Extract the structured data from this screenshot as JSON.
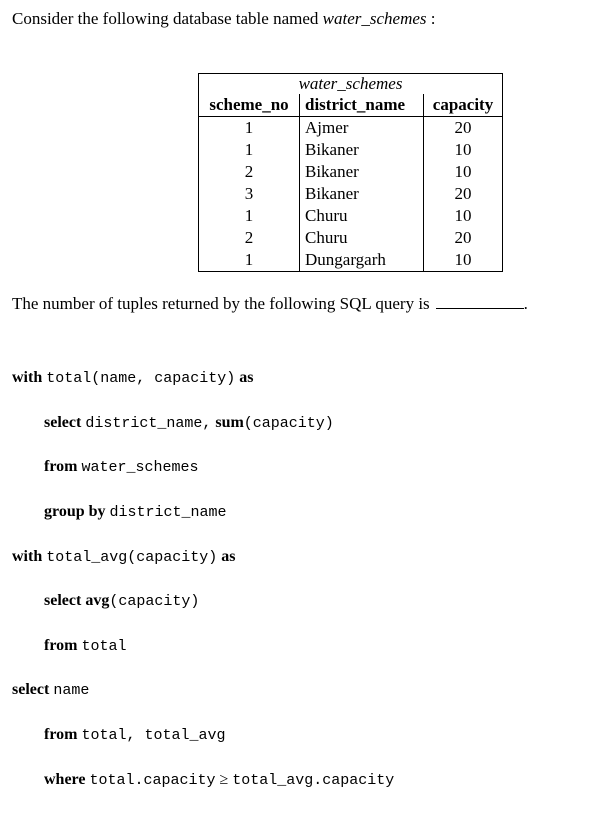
{
  "intro": {
    "prefix": "Consider the following database table named ",
    "table_name": "water_schemes",
    "suffix": " :"
  },
  "table": {
    "caption": "water_schemes",
    "headers": [
      "scheme_no",
      "district_name",
      "capacity"
    ],
    "rows": [
      [
        "1",
        "Ajmer",
        "20"
      ],
      [
        "1",
        "Bikaner",
        "10"
      ],
      [
        "2",
        "Bikaner",
        "10"
      ],
      [
        "3",
        "Bikaner",
        "20"
      ],
      [
        "1",
        "Churu",
        "10"
      ],
      [
        "2",
        "Churu",
        "20"
      ],
      [
        "1",
        "Dungargarh",
        "10"
      ]
    ]
  },
  "question": {
    "text": "The number of tuples returned by the following SQL query is",
    "end": "."
  },
  "sql": {
    "l1_kw": "with",
    "l1_code": "total(name, capacity)",
    "l1_kw2": "as",
    "l2_kw": "select",
    "l2_code": "district_name,",
    "l2_kw2": "sum",
    "l2_code2": "(capacity)",
    "l3_kw": "from",
    "l3_code": "water_schemes",
    "l4_kw": "group by",
    "l4_code": "district_name",
    "l5_kw": "with",
    "l5_code": "total_avg(capacity)",
    "l5_kw2": "as",
    "l6_kw": "select",
    "l6_kw2": "avg",
    "l6_code": "(capacity)",
    "l7_kw": "from",
    "l7_code": "total",
    "l8_kw": "select",
    "l8_code": "name",
    "l9_kw": "from",
    "l9_code": "total, total_avg",
    "l10_kw": "where",
    "l10_code": "total.capacity",
    "l10_op": "≥",
    "l10_code2": "total_avg.capacity"
  }
}
